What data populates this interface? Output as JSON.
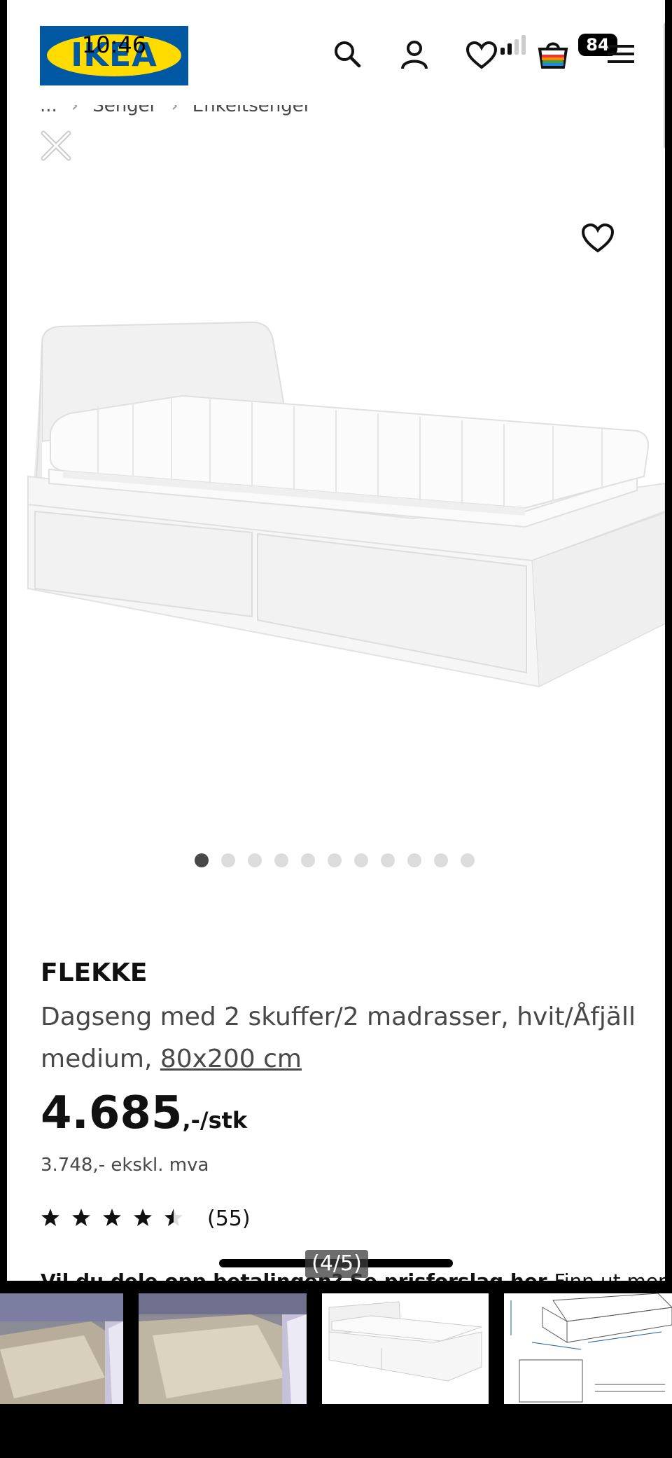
{
  "status_bar": {
    "time": "10:46",
    "battery": "84"
  },
  "header": {
    "logo_text": "IKEA",
    "icons": [
      "search-icon",
      "profile-icon",
      "favourites-icon",
      "cart-icon",
      "menu-icon"
    ]
  },
  "breadcrumb": {
    "items": [
      "...",
      "Senger",
      "Enkeltsenger"
    ]
  },
  "gallery": {
    "dot_count": 11,
    "active_index": 0
  },
  "product": {
    "name": "FLEKKE",
    "description": "Dagseng med 2 skuffer/2 madrasser, hvit/Åfjäll medium,",
    "size_link": "80x200 cm",
    "price": "4.685",
    "price_suffix": ",-/stk",
    "price_ex_vat": "3.748,- ekskl. mva",
    "rating": 4.5,
    "rating_max": 5,
    "review_count": "(55)"
  },
  "promo": {
    "bold_text": "Vil du dele opp betalingen? Se prisforslag her",
    "link_text": "Finn ut mer"
  },
  "viewer": {
    "page_counter": "(4/5)"
  },
  "thumbnails": [
    "bedroom-photo-1",
    "bedroom-photo-2",
    "product-render",
    "dimension-drawing"
  ],
  "colors": {
    "ikea_blue": "#0058A3",
    "ikea_yellow": "#FFDB00"
  }
}
